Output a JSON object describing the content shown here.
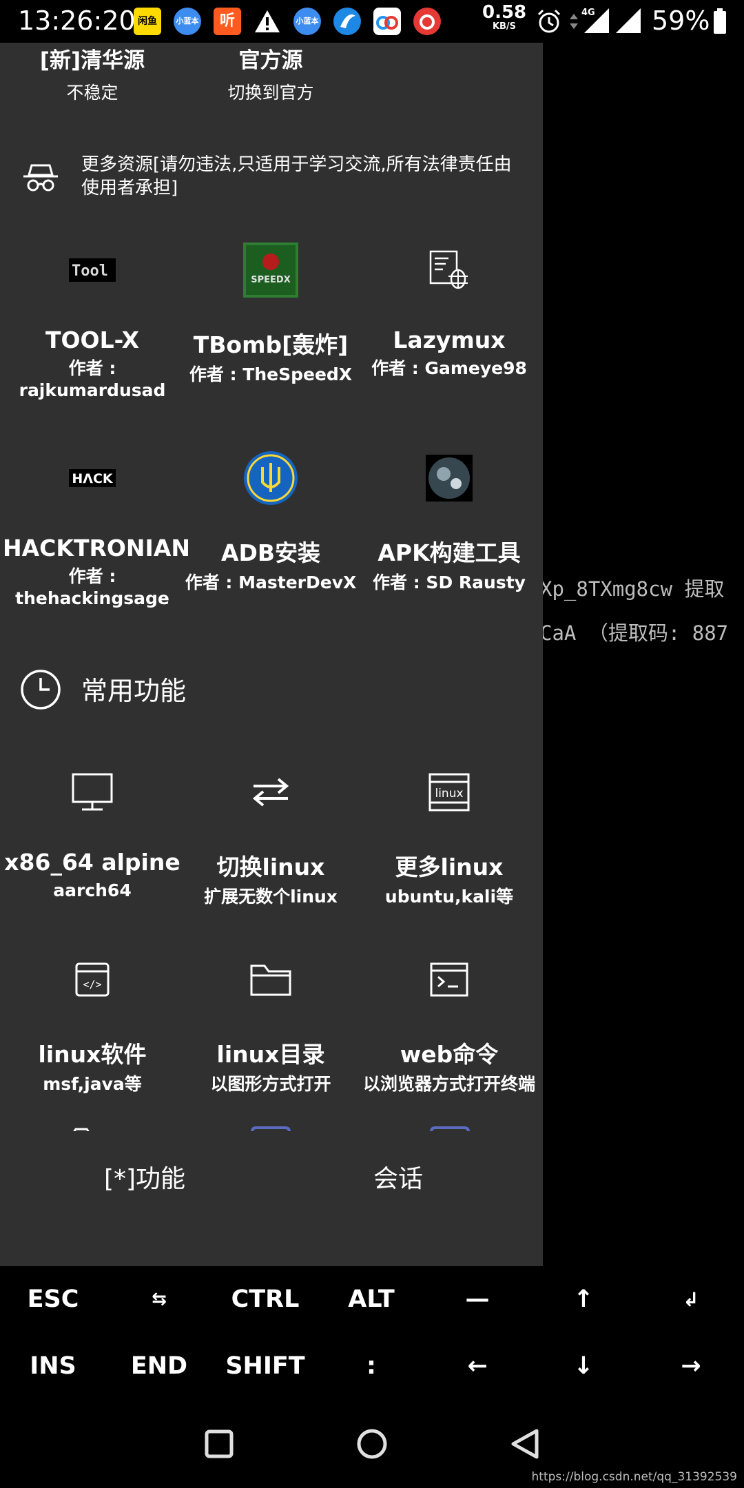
{
  "status_bar": {
    "time": "13:26:20",
    "notifications": [
      {
        "name": "xianyu-app-icon",
        "label": "闲鱼",
        "color": "#ffda00",
        "text_color": "#000000"
      },
      {
        "name": "xiaolanben-app-icon",
        "label": "小蓝本",
        "color": "#3d8cf0",
        "text_color": "#ffffff"
      },
      {
        "name": "ting-app-icon",
        "label": "听",
        "color": "#ff5a1f",
        "text_color": "#ffffff"
      },
      {
        "name": "warning-icon",
        "label": "",
        "color": "#000000",
        "text_color": "#ffffff"
      },
      {
        "name": "xiaolanben-app-icon-2",
        "label": "小蓝本",
        "color": "#3d8cf0",
        "text_color": "#ffffff"
      },
      {
        "name": "browser-app-icon",
        "label": "",
        "color": "#1e88e5",
        "text_color": "#ffffff"
      },
      {
        "name": "baidu-netdisk-app-icon",
        "label": "",
        "color": "#ffffff",
        "text_color": "#2196f3"
      },
      {
        "name": "netease-music-app-icon",
        "label": "",
        "color": "#e53935",
        "text_color": "#ffffff"
      }
    ],
    "net_speed_value": "0.58",
    "net_speed_unit": "KB/S",
    "network_type": "4G",
    "battery": "59%"
  },
  "terminal": {
    "line1": "Xp_8TXmg8cw 提取",
    "line2": "CaA （提取码: 887"
  },
  "drawer": {
    "sources": [
      {
        "title": "[新]清华源",
        "subtitle": "不稳定"
      },
      {
        "title": "官方源",
        "subtitle": "切换到官方"
      }
    ],
    "more_resources": {
      "icon": "incognito-spy-icon",
      "text": "更多资源[请勿违法,只适用于学习交流,所有法律责任由使用者承担]"
    },
    "tools": [
      {
        "name": "tool-x",
        "icon": "tool-x-logo",
        "title": "TOOL-X",
        "author": "作者 : rajkumardusad"
      },
      {
        "name": "tbomb",
        "icon": "speedx-logo",
        "title": "TBomb[轰炸]",
        "author": "作者 : TheSpeedX"
      },
      {
        "name": "lazymux",
        "icon": "bug-script-icon",
        "title": "Lazymux",
        "author": "作者 : Gameye98"
      },
      {
        "name": "hacktronian",
        "icon": "hack-logo",
        "title": "HACKTRONIAN",
        "author": "作者 : thehackingsage"
      },
      {
        "name": "adb-install",
        "icon": "trident-emblem-icon",
        "title": "ADB安装",
        "author": "作者 : MasterDevX"
      },
      {
        "name": "apk-builder",
        "icon": "globe-image-icon",
        "title": "APK构建工具",
        "author": "作者 : SD Rausty"
      }
    ],
    "common_section": {
      "icon": "clock-icon",
      "title": "常用功能"
    },
    "features": [
      {
        "name": "x86-alpine",
        "icon": "monitor-icon",
        "title": "x86_64 alpine",
        "subtitle": "aarch64"
      },
      {
        "name": "switch-linux",
        "icon": "swap-arrows-icon",
        "title": "切换linux",
        "subtitle": "扩展无数个linux"
      },
      {
        "name": "more-linux",
        "icon": "linux-badge-icon",
        "title": "更多linux",
        "subtitle": "ubuntu,kali等"
      },
      {
        "name": "linux-software",
        "icon": "code-window-icon",
        "title": "linux软件",
        "subtitle": "msf,java等"
      },
      {
        "name": "linux-directory",
        "icon": "folder-icon",
        "title": "linux目录",
        "subtitle": "以图形方式打开"
      },
      {
        "name": "web-command",
        "icon": "terminal-window-icon",
        "title": "web命令",
        "subtitle": "以浏览器方式打开终端"
      }
    ],
    "footer": {
      "features_label": "[*]功能",
      "session_label": "会话"
    }
  },
  "extra_keys": {
    "row1": [
      "ESC",
      "⇆",
      "CTRL",
      "ALT",
      "—",
      "↑",
      "↲"
    ],
    "row2": [
      "INS",
      "END",
      "SHIFT",
      ":",
      "←",
      "↓",
      "→"
    ]
  },
  "watermark": "https://blog.csdn.net/qq_31392539",
  "colors": {
    "drawer_bg": "#303030",
    "screen_bg": "#000000",
    "accent_partial_icon": "#5c6bc0"
  }
}
